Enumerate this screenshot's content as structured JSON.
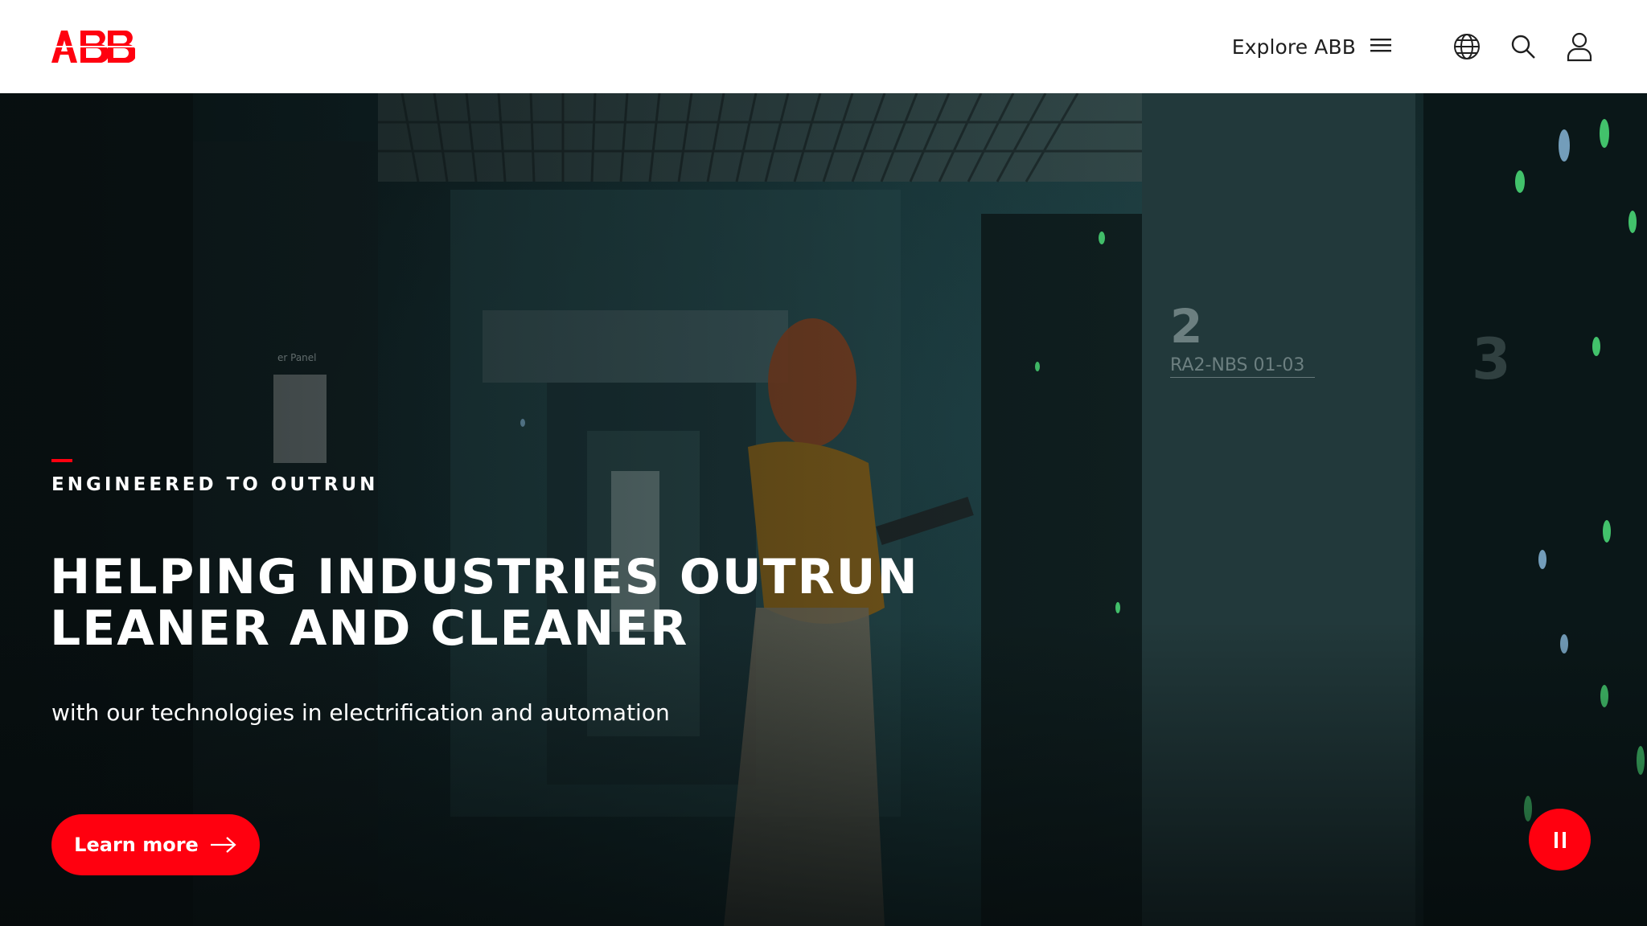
{
  "header": {
    "logo_text": "ABB",
    "explore_label": "Explore ABB",
    "icons": {
      "menu": "menu-icon",
      "globe": "globe-icon",
      "search": "search-icon",
      "user": "user-icon"
    }
  },
  "hero": {
    "eyebrow": "ENGINEERED TO OUTRUN",
    "headline_line1": "HELPING INDUSTRIES OUTRUN",
    "headline_line2": "LEANER AND CLEANER",
    "subhead": "with our technologies in electrification and automation",
    "cta_label": "Learn more",
    "cta_icon": "arrow-right-icon",
    "pause_icon": "pause-icon",
    "background_texts": {
      "rack_number": "2",
      "rack_label": "RA2-NBS 01-03",
      "side_number": "3",
      "panel_label": "er Panel"
    }
  },
  "colors": {
    "brand_red": "#ff000f",
    "header_bg": "#ffffff",
    "text_dark": "#1f1f1f",
    "text_light": "#ffffff"
  }
}
